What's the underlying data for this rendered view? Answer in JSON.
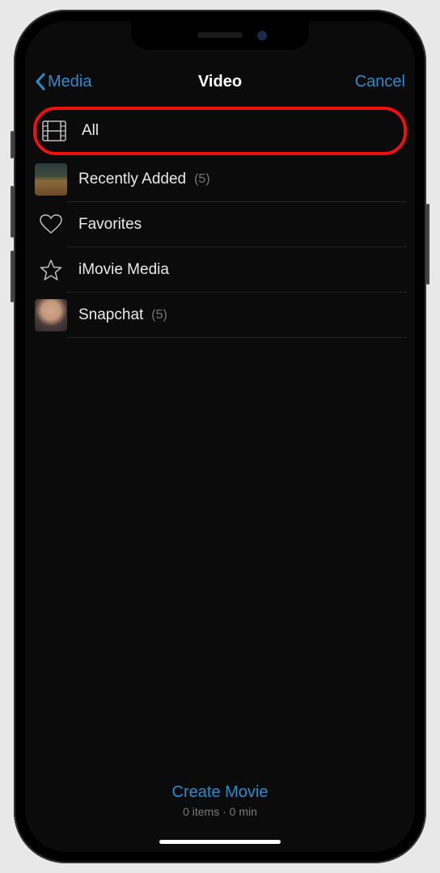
{
  "nav": {
    "back_label": "Media",
    "title": "Video",
    "cancel_label": "Cancel"
  },
  "items": [
    {
      "label": "All",
      "count": "",
      "icon": "film",
      "highlighted": true
    },
    {
      "label": "Recently Added",
      "count": "(5)",
      "icon": "thumb-room"
    },
    {
      "label": "Favorites",
      "count": "",
      "icon": "heart"
    },
    {
      "label": "iMovie Media",
      "count": "",
      "icon": "star"
    },
    {
      "label": "Snapchat",
      "count": "(5)",
      "icon": "thumb-face"
    }
  ],
  "footer": {
    "create_label": "Create Movie",
    "status": "0 items · 0 min"
  }
}
